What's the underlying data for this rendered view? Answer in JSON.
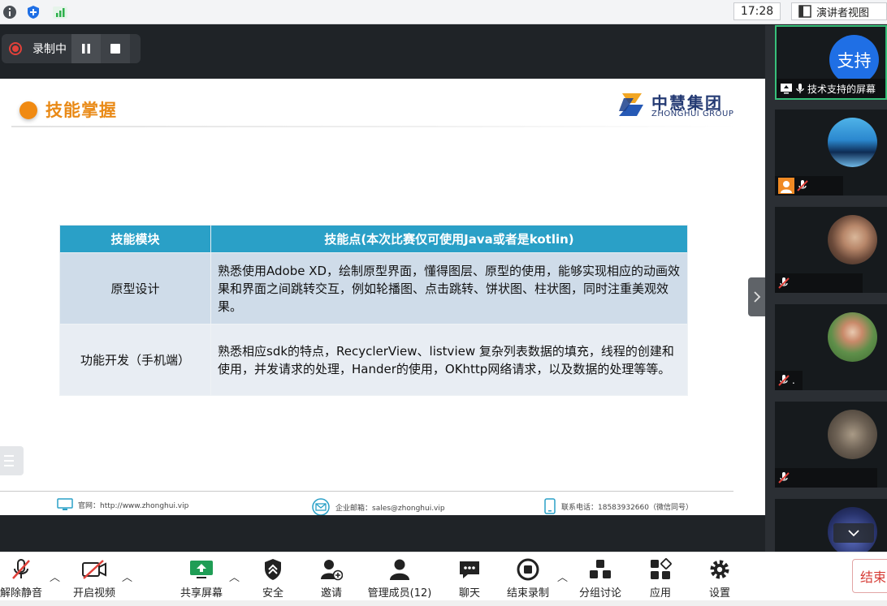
{
  "topbar": {
    "clock": "17:28",
    "presenter_view": "演讲者视图"
  },
  "recording": {
    "label": "录制中"
  },
  "slide": {
    "title": "技能掌握",
    "logo_cn": "中慧集团",
    "logo_en": "ZHONGHUI GROUP",
    "table": {
      "headers": [
        "技能模块",
        "技能点(本次比赛仅可使用Java或者是kotlin)"
      ],
      "rows": [
        {
          "module": "原型设计",
          "points": "熟悉使用Adobe XD，绘制原型界面，懂得图层、原型的使用，能够实现相应的动画效果和界面之间跳转交互，例如轮播图、点击跳转、饼状图、柱状图，同时注重美观效果。"
        },
        {
          "module": "功能开发（手机端）",
          "points": "熟悉相应sdk的特点，RecyclerView、listview 复杂列表数据的填充，线程的创建和使用，并发请求的处理，Hander的使用，OKhttp网络请求，以及数据的处理等等。"
        }
      ]
    },
    "footer": {
      "website": "官网：http://www.zhonghui.vip",
      "email": "企业邮箱：sales@zhonghui.vip",
      "phone": "联系电话：18583932660（微信同号）"
    }
  },
  "participants": [
    {
      "avatar_text": "支持",
      "name": "技术支持的屏幕",
      "active": true
    },
    {
      "name": "",
      "muted": true
    },
    {
      "name": "",
      "muted": true
    },
    {
      "name": ".",
      "muted": true
    },
    {
      "name": "",
      "muted": true
    },
    {
      "name": ""
    }
  ],
  "toolbar": {
    "items": [
      {
        "label": "解除静音",
        "icon": "mic-muted-icon"
      },
      {
        "label": "开启视频",
        "icon": "video-off-icon"
      },
      {
        "label": "共享屏幕",
        "icon": "share-screen-icon"
      },
      {
        "label": "安全",
        "icon": "shield-icon"
      },
      {
        "label": "邀请",
        "icon": "invite-icon"
      },
      {
        "label": "管理成员(12)",
        "icon": "members-icon"
      },
      {
        "label": "聊天",
        "icon": "chat-icon"
      },
      {
        "label": "结束录制",
        "icon": "stop-record-icon"
      },
      {
        "label": "分组讨论",
        "icon": "breakout-icon"
      },
      {
        "label": "应用",
        "icon": "apps-icon"
      },
      {
        "label": "设置",
        "icon": "gear-icon"
      }
    ],
    "end_label": "结束"
  },
  "colors": {
    "accent_orange": "#e98a17",
    "table_header": "#2aa0c7",
    "record_red": "#e0413a",
    "active_green": "#37c07a"
  }
}
